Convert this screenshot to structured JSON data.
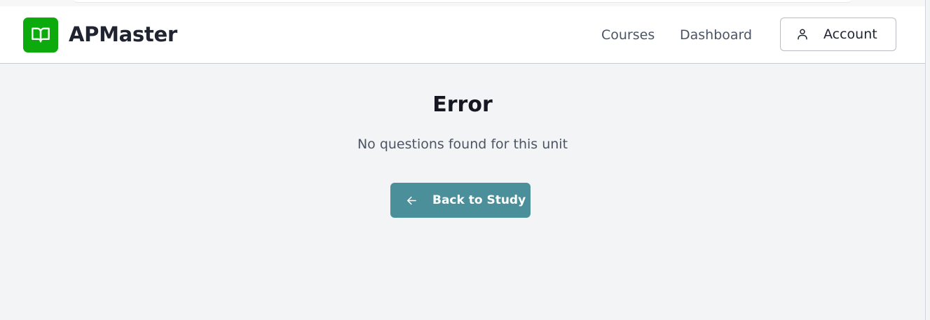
{
  "header": {
    "brand": "APMaster",
    "logo_icon": "open-book-icon",
    "nav": [
      {
        "label": "Courses"
      },
      {
        "label": "Dashboard"
      }
    ],
    "account": {
      "label": "Account",
      "icon": "user-icon"
    }
  },
  "main": {
    "title": "Error",
    "message": "No questions found for this unit",
    "back_button": {
      "label": "Back to Study",
      "icon": "arrow-left-icon"
    }
  },
  "colors": {
    "brand_green": "#0daa0d",
    "button_teal": "#4a8f9a",
    "page_bg": "#f3f4f6"
  }
}
